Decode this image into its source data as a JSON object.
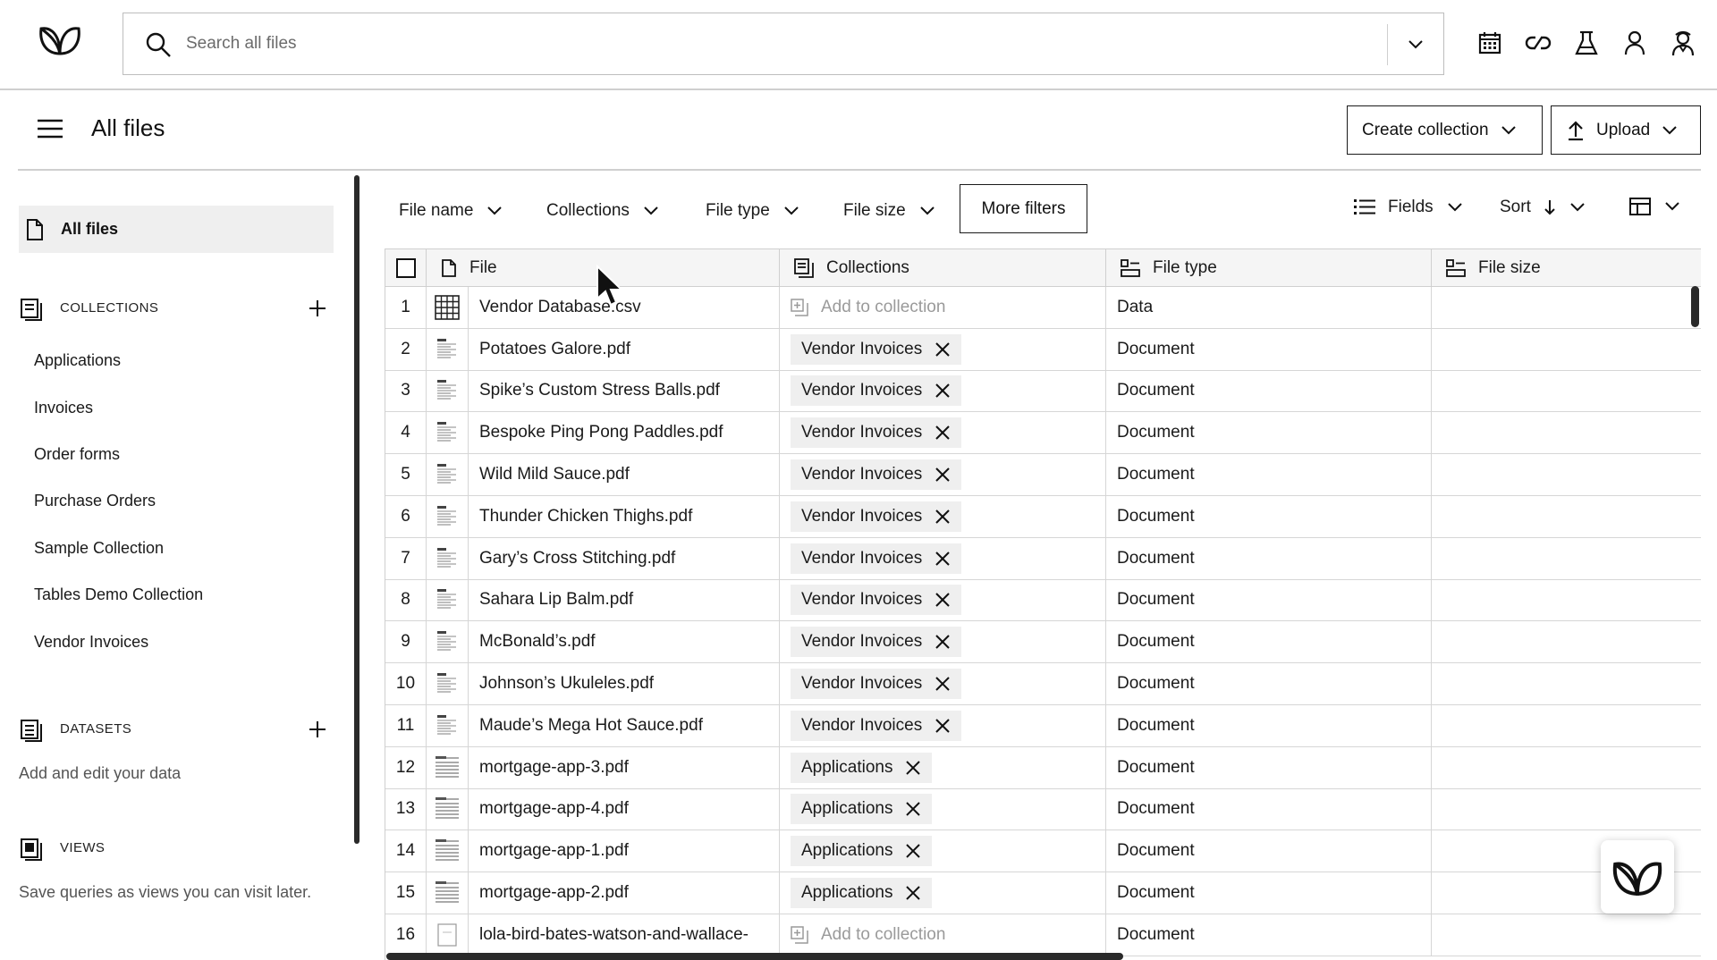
{
  "search": {
    "placeholder": "Search all files"
  },
  "top_icons": [
    "calendar-icon",
    "link-icon",
    "flask-icon",
    "user-icon",
    "agent-icon"
  ],
  "page": {
    "title": "All files"
  },
  "header_buttons": {
    "create_collection": "Create collection",
    "upload": "Upload"
  },
  "sidebar": {
    "all_files": "All files",
    "collections": {
      "title": "COLLECTIONS",
      "items": [
        "Applications",
        "Invoices",
        "Order forms",
        "Purchase Orders",
        "Sample Collection",
        "Tables Demo Collection",
        "Vendor Invoices"
      ]
    },
    "datasets": {
      "title": "DATASETS",
      "subtitle": "Add and edit your data"
    },
    "views": {
      "title": "VIEWS",
      "subtitle": "Save queries as views you can visit later."
    }
  },
  "filters": {
    "file_name": "File name",
    "collections": "Collections",
    "file_type": "File type",
    "file_size": "File size",
    "more_filters": "More filters",
    "fields": "Fields",
    "sort": "Sort"
  },
  "table": {
    "columns": {
      "file": "File",
      "collections": "Collections",
      "file_type": "File type",
      "file_size": "File size"
    },
    "add_to_collection": "Add to collection",
    "rows": [
      {
        "num": "1",
        "file": "Vendor Database.csv",
        "collection": "",
        "type": "Data",
        "thumb": "grid"
      },
      {
        "num": "2",
        "file": "Potatoes Galore.pdf",
        "collection": "Vendor Invoices",
        "type": "Document",
        "thumb": "doc"
      },
      {
        "num": "3",
        "file": "Spike’s Custom Stress Balls.pdf",
        "collection": "Vendor Invoices",
        "type": "Document",
        "thumb": "doc"
      },
      {
        "num": "4",
        "file": "Bespoke Ping Pong Paddles.pdf",
        "collection": "Vendor Invoices",
        "type": "Document",
        "thumb": "doc"
      },
      {
        "num": "5",
        "file": "Wild Mild Sauce.pdf",
        "collection": "Vendor Invoices",
        "type": "Document",
        "thumb": "doc"
      },
      {
        "num": "6",
        "file": "Thunder Chicken Thighs.pdf",
        "collection": "Vendor Invoices",
        "type": "Document",
        "thumb": "doc"
      },
      {
        "num": "7",
        "file": "Gary’s Cross Stitching.pdf",
        "collection": "Vendor Invoices",
        "type": "Document",
        "thumb": "doc"
      },
      {
        "num": "8",
        "file": "Sahara Lip Balm.pdf",
        "collection": "Vendor Invoices",
        "type": "Document",
        "thumb": "doc"
      },
      {
        "num": "9",
        "file": "McBonald’s.pdf",
        "collection": "Vendor Invoices",
        "type": "Document",
        "thumb": "doc"
      },
      {
        "num": "10",
        "file": "Johnson’s Ukuleles.pdf",
        "collection": "Vendor Invoices",
        "type": "Document",
        "thumb": "doc"
      },
      {
        "num": "11",
        "file": "Maude’s Mega Hot Sauce.pdf",
        "collection": "Vendor Invoices",
        "type": "Document",
        "thumb": "doc"
      },
      {
        "num": "12",
        "file": "mortgage-app-3.pdf",
        "collection": "Applications",
        "type": "Document",
        "thumb": "form"
      },
      {
        "num": "13",
        "file": "mortgage-app-4.pdf",
        "collection": "Applications",
        "type": "Document",
        "thumb": "form"
      },
      {
        "num": "14",
        "file": "mortgage-app-1.pdf",
        "collection": "Applications",
        "type": "Document",
        "thumb": "form"
      },
      {
        "num": "15",
        "file": "mortgage-app-2.pdf",
        "collection": "Applications",
        "type": "Document",
        "thumb": "form"
      },
      {
        "num": "16",
        "file": "lola-bird-bates-watson-and-wallace-",
        "collection": "",
        "type": "Document",
        "thumb": "blank"
      }
    ]
  }
}
